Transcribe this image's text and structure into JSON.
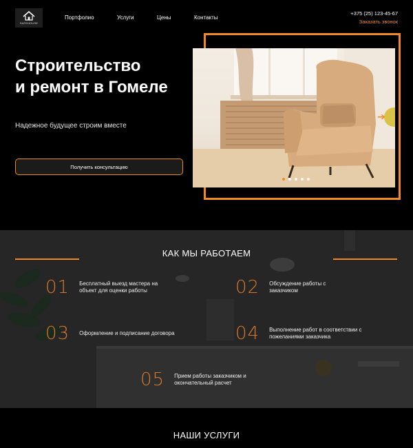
{
  "header": {
    "logo_text": "SAFEHOUSE",
    "nav": [
      "Портфолио",
      "Услуги",
      "Цены",
      "Контакты"
    ],
    "phone": "+375 (25) 123-45-67",
    "callback": "Заказать звонок"
  },
  "hero": {
    "title_line1": "Строительство",
    "title_line2": "и ремонт в Гомеле",
    "subtitle": "Надежное будущее строим вместе",
    "cta": "Получить консультацию",
    "slider_count": 5,
    "slider_active": 1
  },
  "how": {
    "title": "КАК МЫ РАБОТАЕМ",
    "steps": [
      {
        "num": "01",
        "text": "Бесплатный выезд мастера на объект для оценки работы"
      },
      {
        "num": "02",
        "text": "Обсуждение работы с заказчиком"
      },
      {
        "num": "03",
        "text": "Оформление и подписание договора"
      },
      {
        "num": "04",
        "text": "Выполнение работ в соответствии с пожеланиями заказчика"
      },
      {
        "num": "05",
        "text": "Прием работы заказчиком и окончательный расчет"
      }
    ]
  },
  "services": {
    "title": "НАШИ УСЛУГИ"
  },
  "colors": {
    "accent": "#f08a24",
    "background": "#000000"
  }
}
